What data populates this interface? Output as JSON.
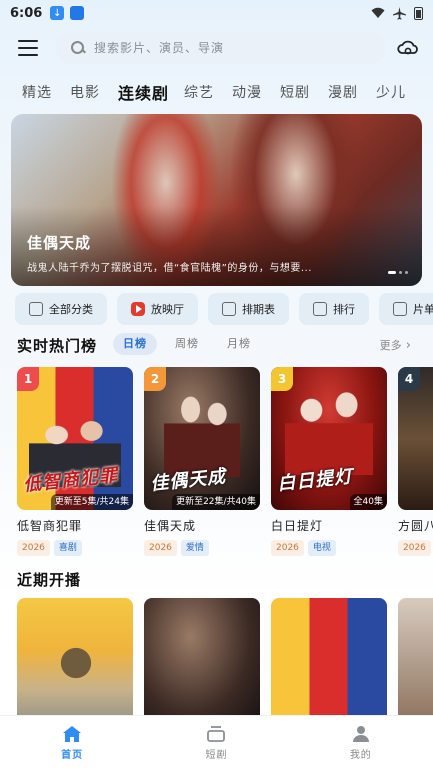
{
  "status_bar": {
    "time": "6:06"
  },
  "search": {
    "placeholder": "搜索影片、演员、导演"
  },
  "tabs": [
    "精选",
    "电影",
    "连续剧",
    "综艺",
    "动漫",
    "短剧",
    "漫剧",
    "少儿"
  ],
  "active_tab": "连续剧",
  "banner": {
    "title": "佳偶天成",
    "description": "战鬼人陆千乔为了摆脱诅咒，借“食官陆槐”的身份，与想要..."
  },
  "quick_links": [
    "全部分类",
    "放映厅",
    "排期表",
    "排行",
    "片单"
  ],
  "hot_section": {
    "title": "实时热门榜",
    "rank_tabs": [
      "日榜",
      "周榜",
      "月榜"
    ],
    "active_rank_tab": "日榜",
    "more_label": "更多",
    "items": [
      {
        "rank": "1",
        "title": "低智商犯罪",
        "poster_text": "低智商犯罪",
        "episode": "更新至5集/共24集",
        "year": "2026",
        "genre": "喜剧"
      },
      {
        "rank": "2",
        "title": "佳偶天成",
        "poster_text": "佳偶天成",
        "episode": "更新至22集/共40集",
        "year": "2026",
        "genre": "爱情"
      },
      {
        "rank": "3",
        "title": "白日提灯",
        "poster_text": "白日提灯",
        "episode": "全40集",
        "year": "2026",
        "genre": "电视"
      },
      {
        "rank": "4",
        "title": "方圆八百米",
        "poster_text": "",
        "episode": "",
        "year": "2026",
        "genre": ""
      }
    ]
  },
  "soon_section": {
    "title": "近期开播"
  },
  "bottom_nav": [
    "首页",
    "短剧",
    "我的"
  ],
  "colors": {
    "accent": "#2f8df5",
    "rank1": "#ee4d4d",
    "rank2": "#f3973a",
    "rank3": "#f2c531"
  }
}
